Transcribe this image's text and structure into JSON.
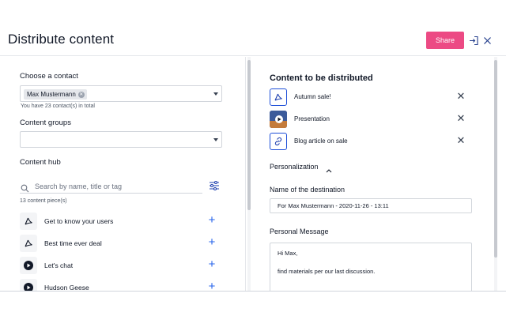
{
  "header": {
    "title": "Distribute content",
    "share_label": "Share"
  },
  "left": {
    "contact_label": "Choose a contact",
    "contact_chip": "Max Mustermann",
    "contact_hint": "You have 23 contact(s) in total",
    "groups_label": "Content groups",
    "hub_label": "Content hub",
    "search_placeholder": "Search by name, title or tag",
    "count_text": "13 content piece(s)",
    "items": [
      {
        "label": "Get to know your users",
        "icon": "pdf-icon"
      },
      {
        "label": "Best time ever deal",
        "icon": "pdf-icon"
      },
      {
        "label": "Let's chat",
        "icon": "video-icon"
      },
      {
        "label": "Hudson Geese",
        "icon": "video-icon"
      }
    ]
  },
  "right": {
    "title": "Content to be distributed",
    "selected": [
      {
        "label": "Autumn sale!",
        "icon": "pdf-icon"
      },
      {
        "label": "Presentation",
        "icon": "video-icon"
      },
      {
        "label": "Blog article on sale",
        "icon": "link-icon"
      }
    ],
    "personalization_label": "Personalization",
    "destination_label": "Name of the destination",
    "destination_value": "For Max Mustermann - 2020-11-26 - 13:11",
    "message_label": "Personal Message",
    "message_line1": "Hi Max,",
    "message_line2": "find materials per our last discussion."
  },
  "colors": {
    "accent": "#ec4a84",
    "link_blue": "#2563eb"
  }
}
